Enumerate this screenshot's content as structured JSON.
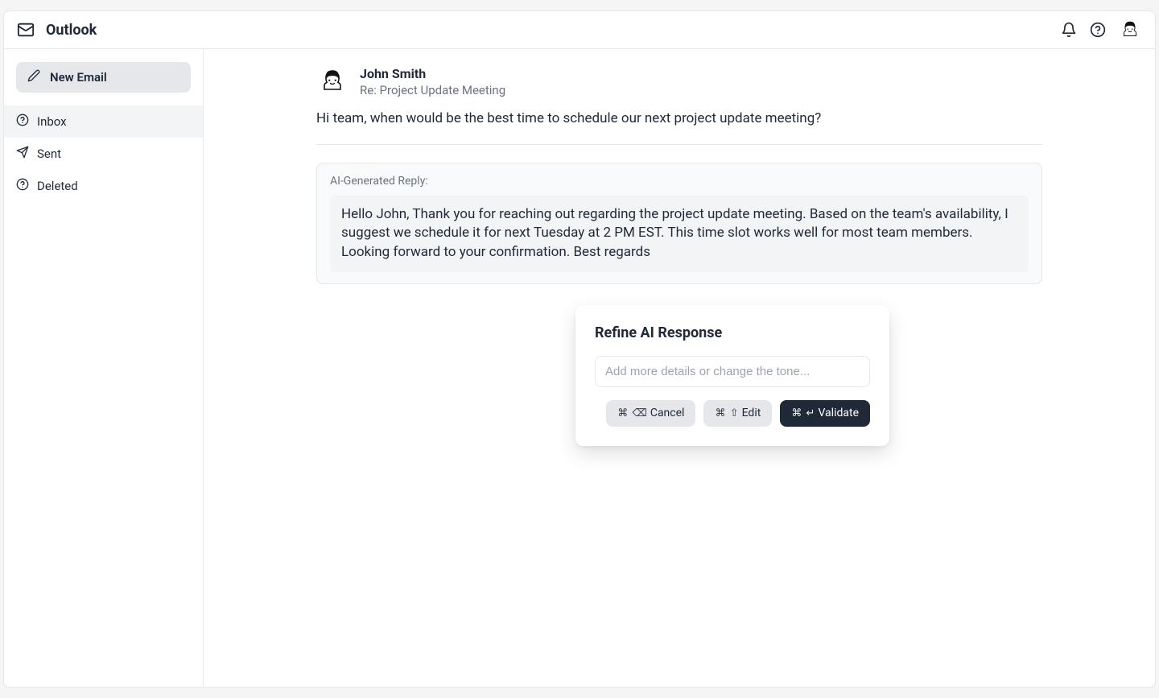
{
  "header": {
    "app_title": "Outlook"
  },
  "sidebar": {
    "new_email_label": "New Email",
    "items": [
      {
        "label": "Inbox",
        "active": true
      },
      {
        "label": "Sent",
        "active": false
      },
      {
        "label": "Deleted",
        "active": false
      }
    ]
  },
  "email": {
    "sender_name": "John Smith",
    "subject": "Re: Project Update Meeting",
    "body": "Hi team, when would be the best time to schedule our next project update meeting?"
  },
  "ai": {
    "label": "AI-Generated Reply:",
    "reply": "Hello John, Thank you for reaching out regarding the project update meeting. Based on the team's availability, I suggest we schedule it for next Tuesday at 2 PM EST. This time slot works well for most team members. Looking forward to your confirmation. Best regards"
  },
  "refine": {
    "title": "Refine AI Response",
    "placeholder": "Add more details or change the tone...",
    "buttons": {
      "cancel": {
        "label": "Cancel",
        "shortcut_cmd": "⌘",
        "shortcut_key": "⌫"
      },
      "edit": {
        "label": "Edit",
        "shortcut_cmd": "⌘",
        "shortcut_key": "⇧"
      },
      "validate": {
        "label": "Validate",
        "shortcut_cmd": "⌘",
        "shortcut_key": "↵"
      }
    }
  }
}
